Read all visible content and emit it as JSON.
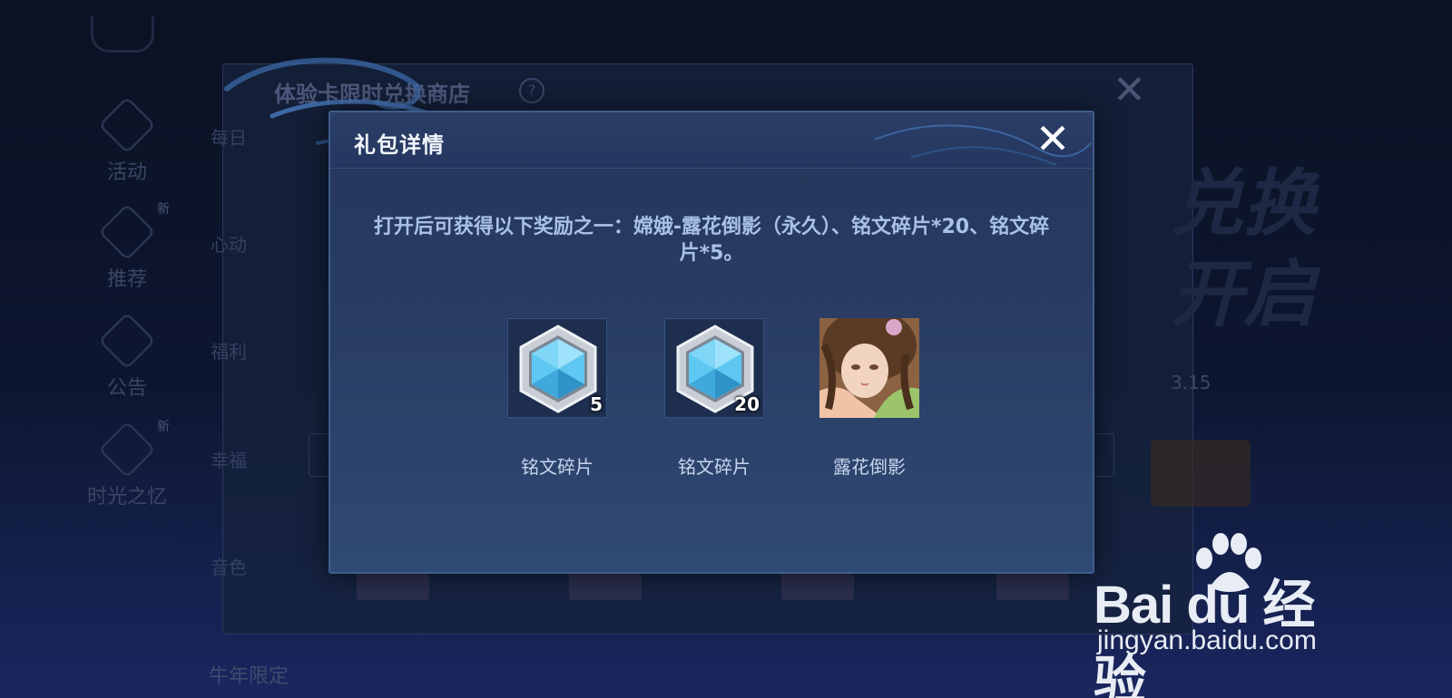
{
  "background": {
    "panel_title": "体验卡限时兑换商店",
    "help_glyph": "?",
    "close_glyph": "✕",
    "side_items": [
      {
        "label": "活动",
        "badge": ""
      },
      {
        "label": "推荐",
        "badge": "新"
      },
      {
        "label": "公告",
        "badge": ""
      },
      {
        "label": "时光之忆",
        "badge": "新"
      }
    ],
    "row_labels": [
      "每日",
      "心动",
      "福利",
      "幸福",
      "音色"
    ],
    "big_text_top": "兑换",
    "big_text_bottom": "开启",
    "date_text": "3.15",
    "bottom_label": "牛年限定"
  },
  "dialog": {
    "title": "礼包详情",
    "close_glyph": "✕",
    "description": "打开后可获得以下奖励之一：嫦娥-露花倒影（永久）、铭文碎片*20、铭文碎片*5。",
    "items": [
      {
        "name": "铭文碎片",
        "quantity": "5",
        "icon": "inscription-shard-icon"
      },
      {
        "name": "铭文碎片",
        "quantity": "20",
        "icon": "inscription-shard-icon"
      },
      {
        "name": "露花倒影",
        "quantity": "",
        "icon": "skin-portrait"
      }
    ]
  },
  "watermark": {
    "brand": "Bai du 经验",
    "url": "jingyan.baidu.com"
  },
  "colors": {
    "dialog_bg": "#2a3f66",
    "dialog_border": "#3f5d8c",
    "title_text": "#f2f5fb",
    "desc_text": "#a9c0e8",
    "crystal": "#5ec8f2"
  }
}
